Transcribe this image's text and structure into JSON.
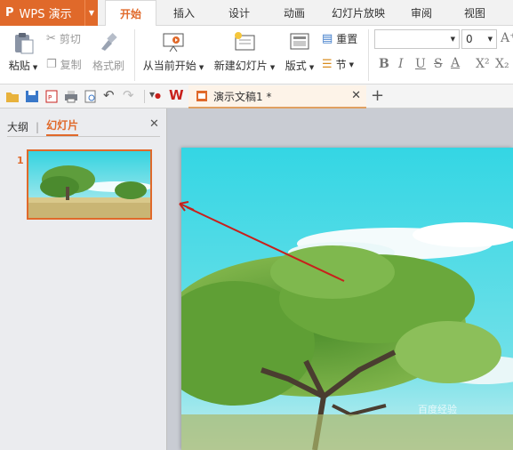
{
  "app": {
    "logo": "P",
    "name": "WPS 演示"
  },
  "menu": {
    "tabs": [
      {
        "label": "开始",
        "active": true
      },
      {
        "label": "插入"
      },
      {
        "label": "设计"
      },
      {
        "label": "动画"
      },
      {
        "label": "幻灯片放映"
      },
      {
        "label": "审阅"
      },
      {
        "label": "视图"
      }
    ]
  },
  "ribbon": {
    "paste": "粘贴",
    "cut": "剪切",
    "copy": "复制",
    "format_painter": "格式刷",
    "from_current": "从当前开始",
    "new_slide": "新建幻灯片",
    "layout": "版式",
    "reset": "重置",
    "section": "节",
    "font_size": "0",
    "font_bold": "B",
    "font_italic": "I",
    "font_underline": "U",
    "font_strike": "S",
    "font_color": "A",
    "superscript": "X²",
    "subscript": "X₂",
    "font_grow": "A⁺"
  },
  "document": {
    "tab_title": "演示文稿1 *"
  },
  "panel": {
    "tab_outline": "大纲",
    "tab_slides": "幻灯片",
    "slide_number": "1"
  },
  "watermark": "百度经验",
  "colors": {
    "accent": "#e0692a",
    "sky": "#3fd6e0",
    "annotation_arrow": "#c8201c"
  }
}
